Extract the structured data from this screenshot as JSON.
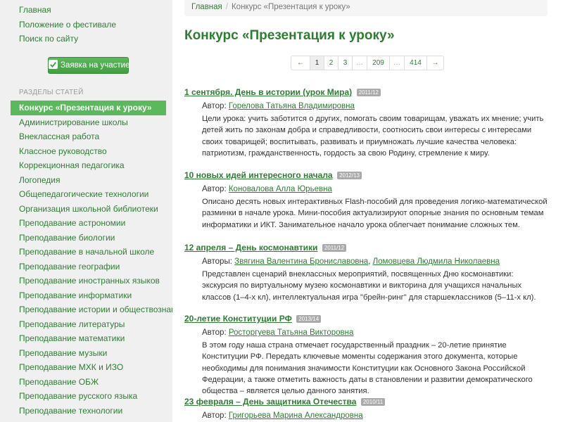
{
  "top_nav": [
    "Главная",
    "Положение о фестивале",
    "Поиск по сайту"
  ],
  "apply_button": "Заявка на участие",
  "sections_heading": "РАЗДЕЛЫ СТАТЕЙ",
  "sections": [
    "Конкурс «Презентация к уроку»",
    "Администрирование школы",
    "Внеклассная работа",
    "Классное руководство",
    "Коррекционная педагогика",
    "Логопедия",
    "Общепедагогические технологии",
    "Организация школьной библиотеки",
    "Преподавание астрономии",
    "Преподавание биологии",
    "Преподавание в начальной школе",
    "Преподавание географии",
    "Преподавание иностранных языков",
    "Преподавание информатики",
    "Преподавание истории и обществознания",
    "Преподавание литературы",
    "Преподавание математики",
    "Преподавание музыки",
    "Преподавание МХК и ИЗО",
    "Преподавание ОБЖ",
    "Преподавание русского языка",
    "Преподавание технологии"
  ],
  "breadcrumb": {
    "home": "Главная",
    "separator": "/",
    "current": "Конкурс «Презентация к уроку»"
  },
  "page_title": "Конкурс «Презентация к уроку»",
  "pagination": {
    "prev": "←",
    "pages": [
      "1",
      "2",
      "3",
      "…",
      "209",
      "…",
      "414"
    ],
    "next": "→",
    "current": "1"
  },
  "articles": [
    {
      "title": "1 сентября. День в истории (урок Мира)",
      "date": "2011/12",
      "author_label": "Автор:",
      "authors": [
        "Горелова Татьяна Владимировна"
      ],
      "description": "Цели урока: учить заботится о других, помогать своим товарищам, уважать их мнение; учить детей жить по законам добра и справедливости, соотносить свои интересы с интересами своих товарищей; воспитывать, развивать и приумножать лучшие качества человека: патриотизм, гражданственность, гордость за свою Родину, стремление к миру."
    },
    {
      "title": "10 новых идей интересного начала",
      "date": "2012/13",
      "author_label": "Автор:",
      "authors": [
        "Коновалова Алла Юрьевна"
      ],
      "description": "Описано десять новых интерактивных Flash-пособий для проведения логико-математической разминки в начале урока. Мини-пособия актуализируют опорные знания по основным темам информатики и ИКТ. Занимательное начало урока облегчает понимание сложных тем."
    },
    {
      "title": "12 апреля – День космонавтики",
      "date": "2011/12",
      "author_label": "Авторы:",
      "authors": [
        "Звягина Валентина Брониславовна",
        "Ломовцева Людмила Николаевна"
      ],
      "description": "Представлен сценарий внеклассных мероприятий, посвященных Дню космонавтики: экскурсия по виртуальному музею космонавтики и викторина для учащихся начальных классов (1–4-х кл), интеллектуальная игра \"брейн-ринг\" для старшеклассников (5–11-х кл)."
    },
    {
      "title": "20-летие Конституции РФ",
      "date": "2013/14",
      "author_label": "Автор:",
      "authors": [
        "Росторгуева Татьяна Викторовна"
      ],
      "description": "В этом году наша страна отмечает государственный праздник – 20-летие принятие Конституции РФ. Передать ключевые моменты содержания этого документа, которые необходимы для понимания значимости Конституции как Основного Закона Российской Федерации, а также отметить важность даты в становлении и развитии демократического общества – является целью данного занятия."
    },
    {
      "title": "23 февраля – День защитника Отечества",
      "date": "2010/11",
      "author_label": "Автор:",
      "authors": [
        "Григорьева Марина Александровна"
      ],
      "description": ""
    }
  ],
  "colors": {
    "link": "#2e7d32",
    "active_bg": "#5cb85c",
    "sidebar_bg": "#f0f0f0",
    "badge_bg": "#aaaaaa"
  }
}
